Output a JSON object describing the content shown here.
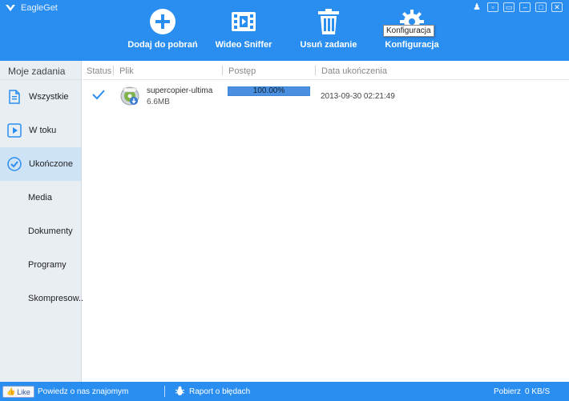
{
  "app": {
    "title": "EagleGet",
    "window_buttons": [
      "shirt-icon",
      "minimize-to-tray-icon",
      "restore-icon",
      "minimize-icon",
      "maximize-icon",
      "close-icon"
    ]
  },
  "toolbar": {
    "add_label": "Dodaj do pobrań",
    "sniffer_label": "Wideo Sniffer",
    "delete_label": "Usuń zadanie",
    "config_label": "Konfiguracja",
    "tooltip": "Konfiguracja"
  },
  "sidebar": {
    "title": "Moje zadania",
    "items": [
      {
        "label": "Wszystkie",
        "icon": "document-icon"
      },
      {
        "label": "W toku",
        "icon": "play-icon"
      },
      {
        "label": "Ukończone",
        "icon": "check-circle-icon",
        "active": true
      },
      {
        "label": "Media"
      },
      {
        "label": "Dokumenty"
      },
      {
        "label": "Programy"
      },
      {
        "label": "Skompresow..."
      }
    ]
  },
  "columns": {
    "status": "Status",
    "file": "Plik",
    "progress": "Postęp",
    "date": "Data ukończenia"
  },
  "downloads": [
    {
      "name": "supercopier-ultima",
      "size": "6.6MB",
      "progress_text": "100.00%",
      "progress": 1.0,
      "date": "2013-09-30 02:21:49",
      "status_icon": "check-icon"
    }
  ],
  "statusbar": {
    "like_label": "Like",
    "share_text": "Powiedz o nas znajomym",
    "report_text": "Raport o błędach",
    "speed_label": "Pobierz",
    "speed_value": "0 KB/S"
  },
  "colors": {
    "accent": "#2a8ef0",
    "sidebar_bg": "#e9eef3",
    "active_item": "#cfe3f6",
    "progress_fill": "#4a8fe0"
  }
}
